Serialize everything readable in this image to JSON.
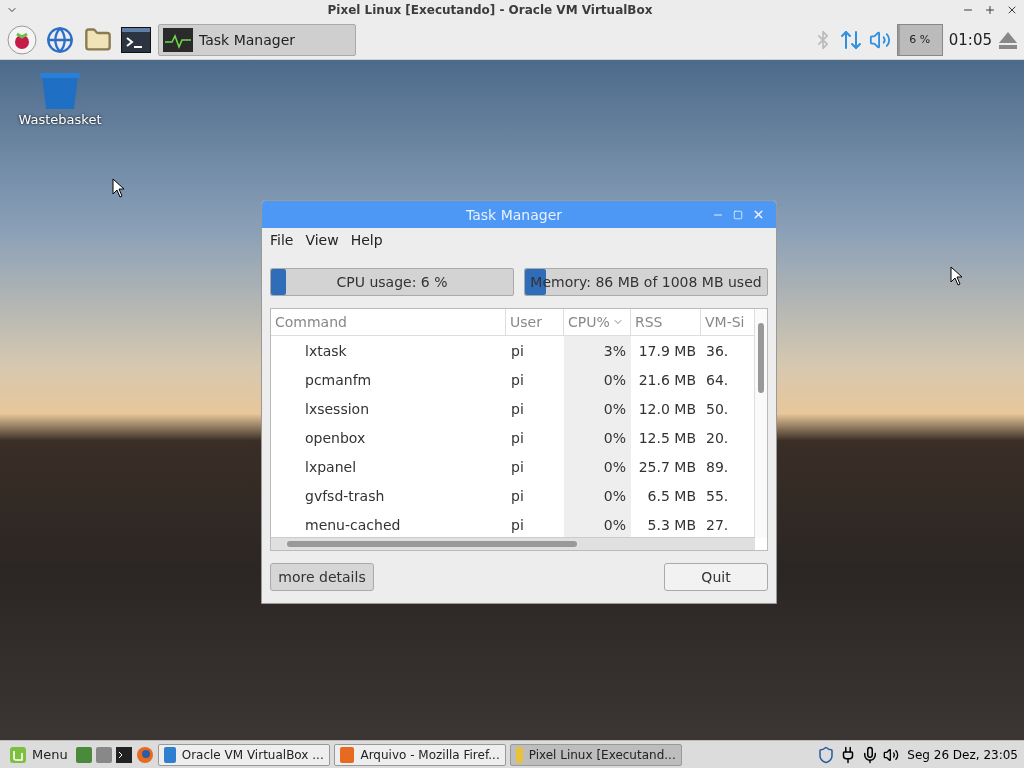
{
  "host_window": {
    "title": "Pixel Linux [Executando] - Oracle VM VirtualBox"
  },
  "guest_panel": {
    "task_button": {
      "label": "Task Manager",
      "selected": true
    },
    "cpu_meter": {
      "label": "6 %",
      "level": 0.06
    },
    "clock": "01:05"
  },
  "desktop_icons": [
    {
      "label": "Wastebasket"
    }
  ],
  "task_manager": {
    "title": "Task Manager",
    "menu": [
      "File",
      "View",
      "Help"
    ],
    "cpu": {
      "label": "CPU usage: 6 %",
      "level": 0.06
    },
    "memory": {
      "label": "Memory: 86 MB of 1008 MB used",
      "level": 0.085
    },
    "columns": [
      {
        "label": "Command",
        "sorted": false
      },
      {
        "label": "User",
        "sorted": false
      },
      {
        "label": "CPU%",
        "sorted": true
      },
      {
        "label": "RSS",
        "sorted": false
      },
      {
        "label": "VM-Si",
        "sorted": false
      }
    ],
    "rows": [
      [
        "lxtask",
        "pi",
        "3%",
        "17.9 MB",
        "36."
      ],
      [
        "pcmanfm",
        "pi",
        "0%",
        "21.6 MB",
        "64."
      ],
      [
        "lxsession",
        "pi",
        "0%",
        "12.0 MB",
        "50."
      ],
      [
        "openbox",
        "pi",
        "0%",
        "12.5 MB",
        "20."
      ],
      [
        "lxpanel",
        "pi",
        "0%",
        "25.7 MB",
        "89."
      ],
      [
        "gvfsd-trash",
        "pi",
        "0%",
        "6.5 MB",
        "55."
      ],
      [
        "menu-cached",
        "pi",
        "0%",
        "5.3 MB",
        "27."
      ]
    ],
    "buttons": [
      "more details",
      "Quit"
    ]
  },
  "host_taskbar": {
    "menu_label": "Menu",
    "tasks": [
      {
        "label": "Oracle VM VirtualBox ...",
        "selected": false
      },
      {
        "label": "Arquivo - Mozilla Firef...",
        "selected": false
      },
      {
        "label": "Pixel Linux [Executand...",
        "selected": true
      }
    ],
    "clock": "Seg 26 Dez, 23:05"
  }
}
